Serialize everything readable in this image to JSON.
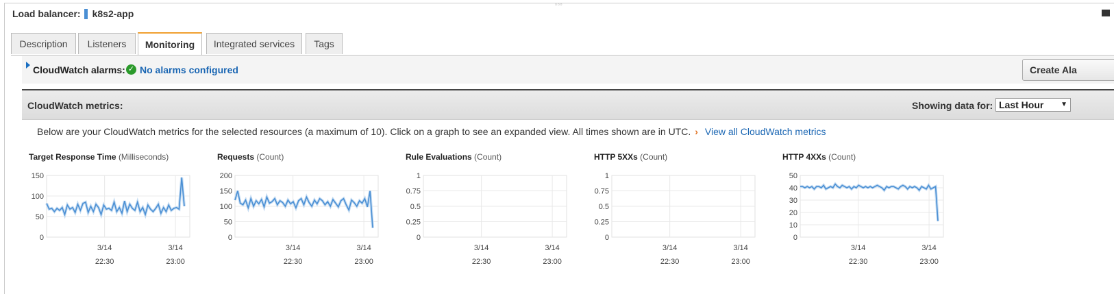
{
  "header": {
    "label": "Load balancer:",
    "name": "k8s2-app"
  },
  "tabs": [
    {
      "label": "Description"
    },
    {
      "label": "Listeners"
    },
    {
      "label": "Monitoring",
      "active": true
    },
    {
      "label": "Integrated services"
    },
    {
      "label": "Tags"
    }
  ],
  "alarms": {
    "label": "CloudWatch alarms:",
    "status": "No alarms configured",
    "create_button": "Create Ala"
  },
  "metrics": {
    "label": "CloudWatch metrics:",
    "showing_label": "Showing data for:",
    "range_value": "Last Hour",
    "description": "Below are your CloudWatch metrics for the selected resources (a maximum of 10). Click on a graph to see an expanded view. All times shown are in UTC.",
    "chevron": "›",
    "view_all_link": "View all CloudWatch metrics"
  },
  "colors": {
    "accent": "#f0a030",
    "link": "#1a66b3",
    "line": "#4a8fd4",
    "ok": "#2b9a2b"
  },
  "chart_data": [
    {
      "type": "line",
      "title": "Target Response Time",
      "unit": "(Milliseconds)",
      "ylim": [
        0,
        150
      ],
      "yticks": [
        "150",
        "100",
        "50",
        "0"
      ],
      "xticks": [
        {
          "date": "3/14",
          "time": "22:30"
        },
        {
          "date": "3/14",
          "time": "23:00"
        }
      ],
      "values": [
        82,
        68,
        70,
        62,
        70,
        65,
        72,
        55,
        78,
        68,
        72,
        60,
        80,
        65,
        82,
        85,
        60,
        75,
        62,
        80,
        72,
        55,
        78,
        68,
        70,
        65,
        85,
        62,
        72,
        58,
        88,
        62,
        80,
        70,
        65,
        85,
        62,
        72,
        55,
        78,
        68,
        62,
        70,
        80,
        58,
        72,
        62,
        78,
        65,
        70,
        72,
        68,
        145,
        75
      ]
    },
    {
      "type": "line",
      "title": "Requests",
      "unit": "(Count)",
      "ylim": [
        0,
        200
      ],
      "yticks": [
        "200",
        "150",
        "100",
        "50",
        "0"
      ],
      "xticks": [
        {
          "date": "3/14",
          "time": "22:30"
        },
        {
          "date": "3/14",
          "time": "23:00"
        }
      ],
      "values": [
        120,
        150,
        110,
        105,
        120,
        95,
        125,
        100,
        118,
        108,
        122,
        98,
        130,
        110,
        115,
        125,
        105,
        118,
        112,
        100,
        120,
        108,
        115,
        95,
        118,
        125,
        105,
        130,
        112,
        100,
        120,
        108,
        125,
        118,
        105,
        115,
        100,
        122,
        110,
        98,
        118,
        125,
        105,
        88,
        120,
        112,
        100,
        118,
        110,
        125,
        98,
        150,
        30
      ]
    },
    {
      "type": "line",
      "title": "Rule Evaluations",
      "unit": "(Count)",
      "ylim": [
        0,
        1
      ],
      "yticks": [
        "1",
        "0.75",
        "0.5",
        "0.25",
        "0"
      ],
      "xticks": [
        {
          "date": "3/14",
          "time": "22:30"
        },
        {
          "date": "3/14",
          "time": "23:00"
        }
      ],
      "values": []
    },
    {
      "type": "line",
      "title": "HTTP 5XXs",
      "unit": "(Count)",
      "ylim": [
        0,
        1
      ],
      "yticks": [
        "1",
        "0.75",
        "0.5",
        "0.25",
        "0"
      ],
      "xticks": [
        {
          "date": "3/14",
          "time": "22:30"
        },
        {
          "date": "3/14",
          "time": "23:00"
        }
      ],
      "values": []
    },
    {
      "type": "line",
      "title": "HTTP 4XXs",
      "unit": "(Count)",
      "ylim": [
        0,
        50
      ],
      "yticks": [
        "50",
        "40",
        "30",
        "20",
        "10",
        "0"
      ],
      "xticks": [
        {
          "date": "3/14",
          "time": "22:30"
        },
        {
          "date": "3/14",
          "time": "23:00"
        }
      ],
      "values": [
        41,
        41,
        40,
        41,
        40,
        41,
        39,
        41,
        41,
        40,
        42,
        39,
        40,
        41,
        40,
        43,
        41,
        40,
        42,
        41,
        40,
        41,
        39,
        41,
        40,
        42,
        41,
        40,
        41,
        40,
        41,
        40,
        41,
        42,
        41,
        40,
        38,
        41,
        40,
        41,
        41,
        40,
        39,
        41,
        42,
        41,
        39,
        41,
        40,
        41,
        40,
        38,
        41,
        40,
        39,
        42,
        39,
        40,
        41,
        13
      ]
    }
  ]
}
